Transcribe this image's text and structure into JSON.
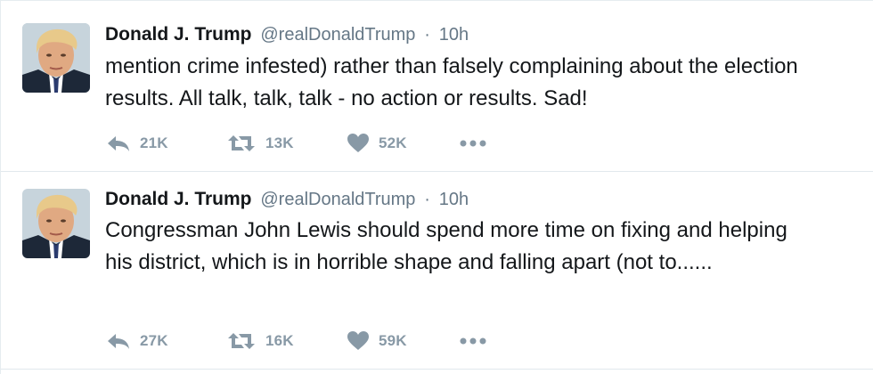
{
  "tweets": [
    {
      "author": {
        "name": "Donald J. Trump",
        "handle": "@realDonaldTrump"
      },
      "separator": "·",
      "time": "10h",
      "text": "mention crime infested) rather than falsely complaining about the election results. All talk, talk, talk - no action or results. Sad!",
      "replies": "21K",
      "retweets": "13K",
      "likes": "52K"
    },
    {
      "author": {
        "name": "Donald J. Trump",
        "handle": "@realDonaldTrump"
      },
      "separator": "·",
      "time": "10h",
      "text": "Congressman John Lewis should spend more time on fixing and helping his district, which is in horrible shape and falling apart (not to......",
      "replies": "27K",
      "retweets": "16K",
      "likes": "59K"
    }
  ],
  "icons": {
    "reply": "reply-icon",
    "retweet": "retweet-icon",
    "like": "heart-icon",
    "more": "more-dots-icon"
  },
  "colors": {
    "text": "#14171a",
    "secondary": "#657786",
    "action": "#8899a6",
    "divider": "#e1e8ed"
  }
}
